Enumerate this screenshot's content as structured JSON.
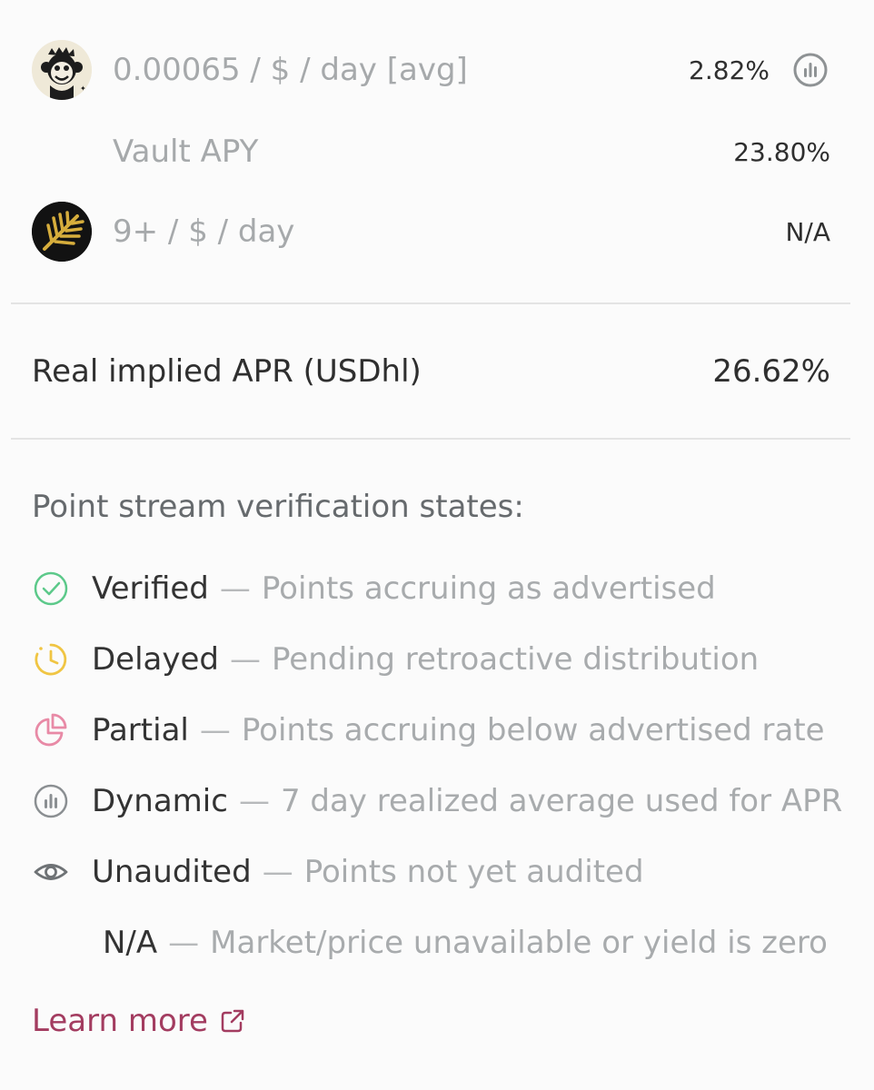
{
  "rewards": [
    {
      "label": "0.00065 / $ / day [avg]",
      "value": "2.82%",
      "icon": "monkey-mascot-icon"
    },
    {
      "label": "Vault APY",
      "value": "23.80%"
    },
    {
      "label": "9+ / $ / day",
      "value": "N/A",
      "icon": "gold-leaf-icon"
    }
  ],
  "implied": {
    "label": "Real implied APR (USDhl)",
    "value": "26.62%"
  },
  "legend": {
    "title": "Point stream verification states:",
    "dash": "—",
    "items": [
      {
        "term": "Verified",
        "desc": "Points accruing as advertised",
        "icon": "check-circle-icon",
        "color": "#5cc98a"
      },
      {
        "term": "Delayed",
        "desc": "Pending retroactive distribution",
        "icon": "clock-icon",
        "color": "#f0c543"
      },
      {
        "term": "Partial",
        "desc": "Points accruing below advertised rate",
        "icon": "pie-chart-icon",
        "color": "#e88aa6"
      },
      {
        "term": "Dynamic",
        "desc": "7 day realized average used for APR",
        "icon": "bar-chart-circle-icon",
        "color": "#8b8f92"
      },
      {
        "term": "Unaudited",
        "desc": "Points not yet audited",
        "icon": "eye-icon",
        "color": "#6e7275"
      },
      {
        "term": "N/A",
        "desc": "Market/price unavailable or yield is zero"
      }
    ]
  },
  "learn_more": "Learn more"
}
